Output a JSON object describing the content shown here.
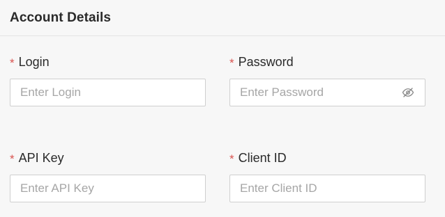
{
  "section": {
    "title": "Account Details"
  },
  "required_marker": "*",
  "fields": {
    "login": {
      "label": "Login",
      "value": "",
      "placeholder": "Enter Login"
    },
    "password": {
      "label": "Password",
      "value": "",
      "placeholder": "Enter Password",
      "toggle_icon": "eye-off-icon"
    },
    "api_key": {
      "label": "API Key",
      "value": "",
      "placeholder": "Enter API Key"
    },
    "client_id": {
      "label": "Client ID",
      "value": "",
      "placeholder": "Enter Client ID"
    }
  },
  "colors": {
    "required": "#d9534f",
    "border": "#cfcfcf",
    "background": "#f7f7f7",
    "placeholder": "#a6a6a6"
  }
}
